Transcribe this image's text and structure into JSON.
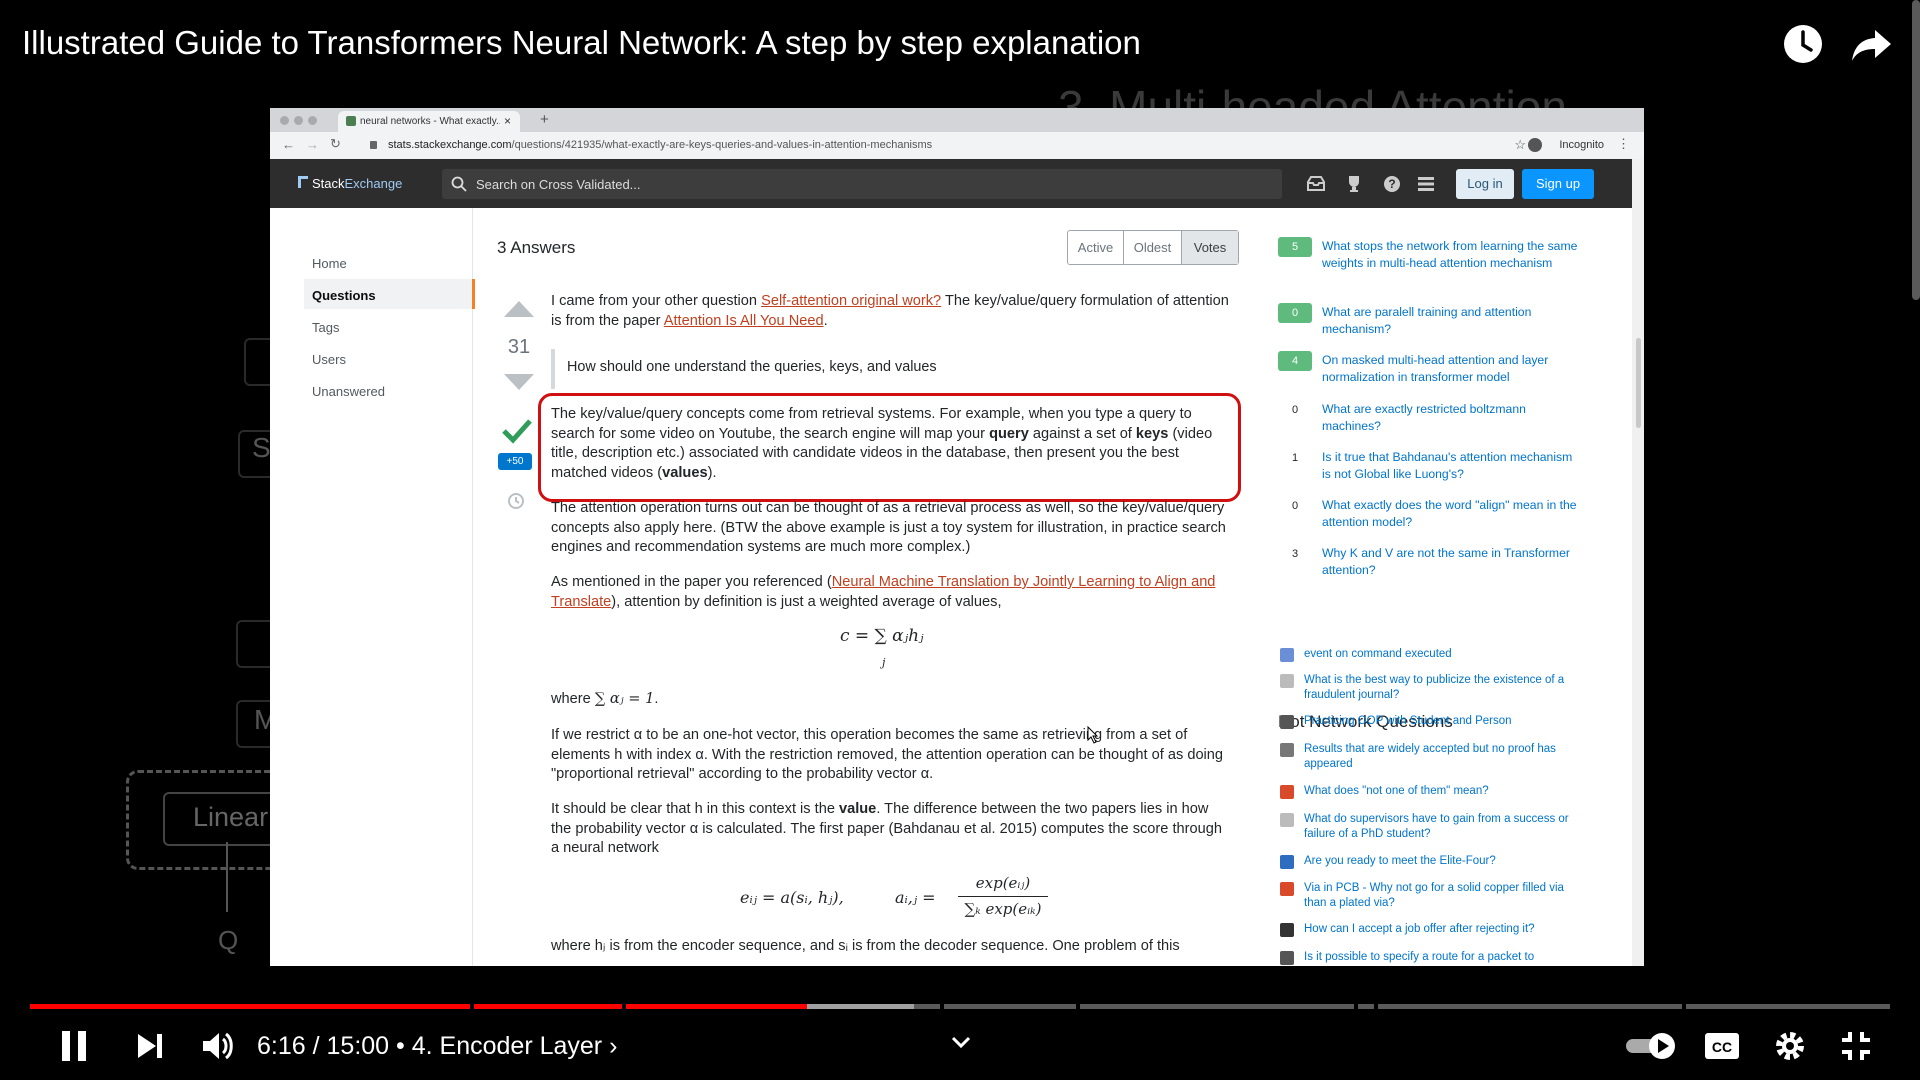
{
  "video": {
    "title": "Illustrated Guide to Transformers Neural Network: A step by step explanation",
    "time_current": "6:16",
    "time_total": "15:00",
    "chapter": "4. Encoder Layer",
    "time_separator": " / ",
    "chapter_prefix": " • ",
    "chapter_chevron": "›",
    "progress_fraction": 0.418,
    "buffered_fraction": 0.475
  },
  "background": {
    "heading": "3. Multi-headed Attention",
    "linear_label": "Linear",
    "q_label": "Q",
    "s_label": "S",
    "m_label": "M"
  },
  "browser": {
    "tab_title": "neural networks - What exactly...",
    "tab_close": "×",
    "new_tab": "+",
    "url_host": "stats.stackexchange.com",
    "url_path": "/questions/421935/what-exactly-are-keys-queries-and-values-in-attention-mechanisms",
    "incognito_label": "Incognito"
  },
  "site": {
    "logo_stack": "Stack",
    "logo_exchange": "Exchange",
    "search_placeholder": "Search on Cross Validated...",
    "login": "Log in",
    "signup": "Sign up"
  },
  "nav": {
    "home": "Home",
    "questions": "Questions",
    "tags": "Tags",
    "users": "Users",
    "unanswered": "Unanswered"
  },
  "answers": {
    "heading": "3 Answers",
    "sort_active": "Active",
    "sort_oldest": "Oldest",
    "sort_votes": "Votes",
    "score": "31",
    "bounty": "+50"
  },
  "answer_body": {
    "p1_a": "I came from your other question ",
    "p1_link1": "Self-attention original work?",
    "p1_b": " The key/value/query formulation of attention is from the paper ",
    "p1_link2": "Attention Is All You Need",
    "p1_c": ".",
    "quote": "How should one understand the queries, keys, and values",
    "p2_a": "The key/value/query concepts come from retrieval systems. For example, when you type a query to search for some video on Youtube, the search engine will map your ",
    "p2_query": "query",
    "p2_b": " against a set of ",
    "p2_keys": "keys",
    "p2_c": " (video title, description etc.) associated with candidate videos in the database, then present you the best matched videos (",
    "p2_values": "values",
    "p2_d": ").",
    "p3": "The attention operation turns out can be thought of as a retrieval process as well, so the key/value/query concepts also apply here. (BTW the above example is just a toy system for illustration, in practice search engines and recommendation systems are much more complex.)",
    "p4_a": "As mentioned in the paper you referenced (",
    "p4_link": "Neural Machine Translation by Jointly Learning to Align and Translate",
    "p4_b": "), attention by definition is just a weighted average of values,",
    "eq1": "c = ∑ αⱼhⱼ",
    "eq1_sub": "j",
    "p5_a": "where ",
    "p5_math": "∑ αⱼ = 1",
    "p5_b": ".",
    "p6": "If we restrict α to be an one-hot vector, this operation becomes the same as retrieving from a set of elements h with index α. With the restriction removed, the attention operation can be thought of as doing \"proportional retrieval\" according to the probability vector α.",
    "p7_a": "It should be clear that h in this context is the ",
    "p7_value": "value",
    "p7_b": ". The difference between the two papers lies in how the probability vector α is calculated. The first paper (Bahdanau et al. 2015) computes the score through a neural network",
    "eq2_left": "eᵢⱼ = a(sᵢ, hⱼ),",
    "eq2_mid": "aᵢ,ⱼ =",
    "eq2_num": "exp(eᵢⱼ)",
    "eq2_den": "∑ₖ exp(eᵢₖ)",
    "p8": "where hⱼ is from the encoder sequence, and sᵢ is from the decoder sequence. One problem of this"
  },
  "linked_questions": [
    {
      "count": "5",
      "answered": true,
      "text": "What stops the network from learning the same weights in multi-head attention mechanism"
    },
    {
      "count": "0",
      "answered": true,
      "text": "What are paralell training and attention mechanism?"
    },
    {
      "count": "4",
      "answered": true,
      "text": "On masked multi-head attention and layer normalization in transformer model"
    },
    {
      "count": "0",
      "answered": false,
      "text": "What are exactly restricted boltzmann machines?"
    },
    {
      "count": "1",
      "answered": false,
      "text": "Is it true that Bahdanau's attention mechanism is not Global like Luong's?"
    },
    {
      "count": "0",
      "answered": false,
      "text": "What exactly does the word \"align\" mean in the attention model?"
    },
    {
      "count": "3",
      "answered": false,
      "text": "Why K and V are not the same in Transformer attention?"
    }
  ],
  "hot_network": {
    "title": "Hot Network Questions",
    "items": [
      {
        "text": "event on command executed",
        "color": "#6a8fd6"
      },
      {
        "text": "What is the best way to publicize the existence of a fraudulent journal?",
        "color": "#bbbbbb"
      },
      {
        "text": "Practicing OOP with Student and Person",
        "color": "#555555"
      },
      {
        "text": "Results that are widely accepted but no proof has appeared",
        "color": "#777777"
      },
      {
        "text": "What does \"not one of them\" mean?",
        "color": "#d94a2b"
      },
      {
        "text": "What do supervisors have to gain from a success or failure of a PhD student?",
        "color": "#bbbbbb"
      },
      {
        "text": "Are you ready to meet the Elite-Four?",
        "color": "#2d6cc0"
      },
      {
        "text": "Via in PCB - Why not go for a solid copper filled via than a plated via?",
        "color": "#d94a2b"
      },
      {
        "text": "How can I accept a job offer after rejecting it?",
        "color": "#333333"
      },
      {
        "text": "Is it possible to specify a route for a packet to",
        "color": "#555555"
      }
    ]
  },
  "colors": {
    "progress_played": "#ff0000",
    "highlight_box": "#d01010",
    "link": "#0074cc",
    "answer_link": "#c04020"
  }
}
